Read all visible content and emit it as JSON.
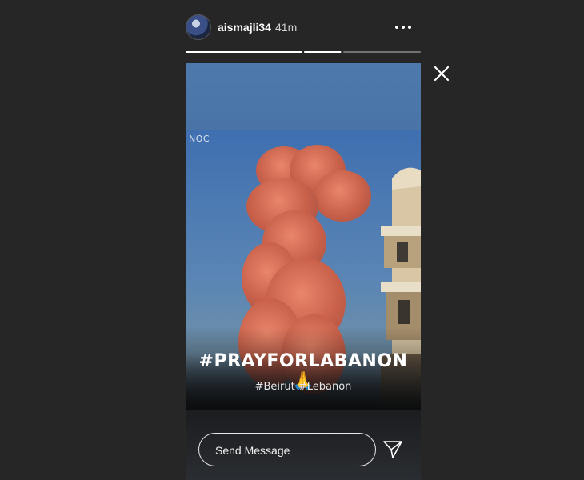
{
  "story": {
    "username": "aismajli34",
    "timestamp": "41m",
    "progress": [
      {
        "fill": 1.0
      },
      {
        "fill": 0.98
      },
      {
        "fill": 0.0
      }
    ]
  },
  "content": {
    "watermark": "NOC",
    "headline": "#PRAYFORLABANON 🙏",
    "hashtags": "#Beirut #Lebanon"
  },
  "footer": {
    "message_placeholder": "Send Message"
  },
  "icons": {
    "more": "more-horizontal-icon",
    "close": "close-icon",
    "send": "paper-plane-icon"
  },
  "colors": {
    "background": "#262626",
    "text": "#ffffff"
  }
}
